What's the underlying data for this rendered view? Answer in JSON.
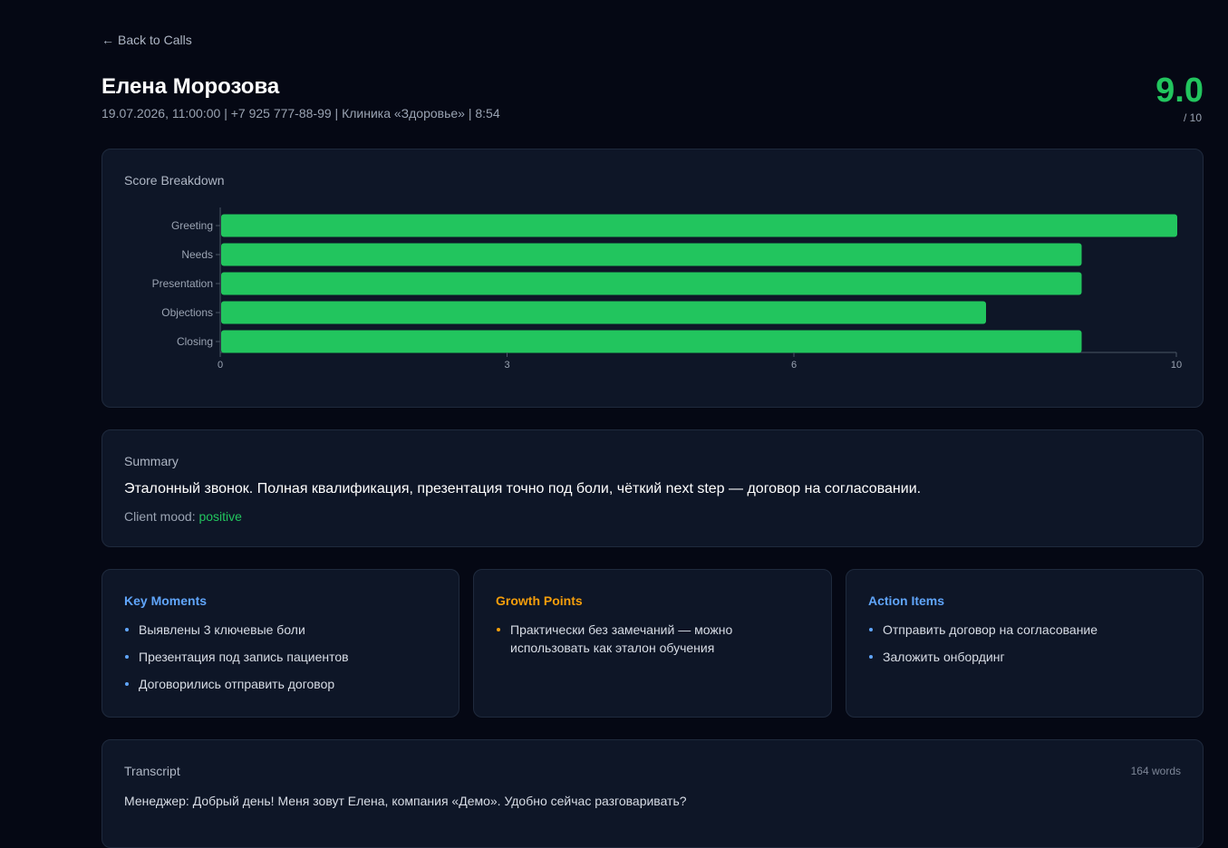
{
  "header": {
    "back_label": "Back to Calls",
    "caller_name": "Елена Морозова",
    "meta": "19.07.2026, 11:00:00 | +7 925 777-88-99 | Клиника «Здоровье» | 8:54",
    "score": "9.0",
    "score_max": "/ 10"
  },
  "score_breakdown": {
    "title": "Score Breakdown"
  },
  "chart_data": {
    "type": "bar",
    "orientation": "horizontal",
    "categories": [
      "Greeting",
      "Needs",
      "Presentation",
      "Objections",
      "Closing"
    ],
    "values": [
      10,
      9,
      9,
      8,
      9
    ],
    "xlim": [
      0,
      10
    ],
    "xticks": [
      0,
      3,
      6,
      10
    ],
    "bar_color": "#22c55e",
    "grid": false,
    "title": "",
    "xlabel": "",
    "ylabel": ""
  },
  "summary": {
    "title": "Summary",
    "text": "Эталонный звонок. Полная квалификация, презентация точно под боли, чёткий next step — договор на согласовании.",
    "mood_label": "Client mood:",
    "mood_value": "positive"
  },
  "key_moments": {
    "title": "Key Moments",
    "items": [
      "Выявлены 3 ключевые боли",
      "Презентация под запись пациентов",
      "Договорились отправить договор"
    ]
  },
  "growth_points": {
    "title": "Growth Points",
    "items": [
      "Практически без замечаний — можно использовать как эталон обучения"
    ]
  },
  "action_items": {
    "title": "Action Items",
    "items": [
      "Отправить договор на согласование",
      "Заложить онбординг"
    ]
  },
  "transcript": {
    "title": "Transcript",
    "word_count": "164 words",
    "first_line": "Менеджер: Добрый день! Меня зовут Елена, компания «Демо». Удобно сейчас разговаривать?"
  },
  "colors": {
    "background": "#050814",
    "card": "#0e1627",
    "accent_green": "#22c55e",
    "accent_blue": "#60a5fa",
    "accent_orange": "#f59e0b"
  },
  "icons": {
    "back": "arrow-left-icon"
  }
}
